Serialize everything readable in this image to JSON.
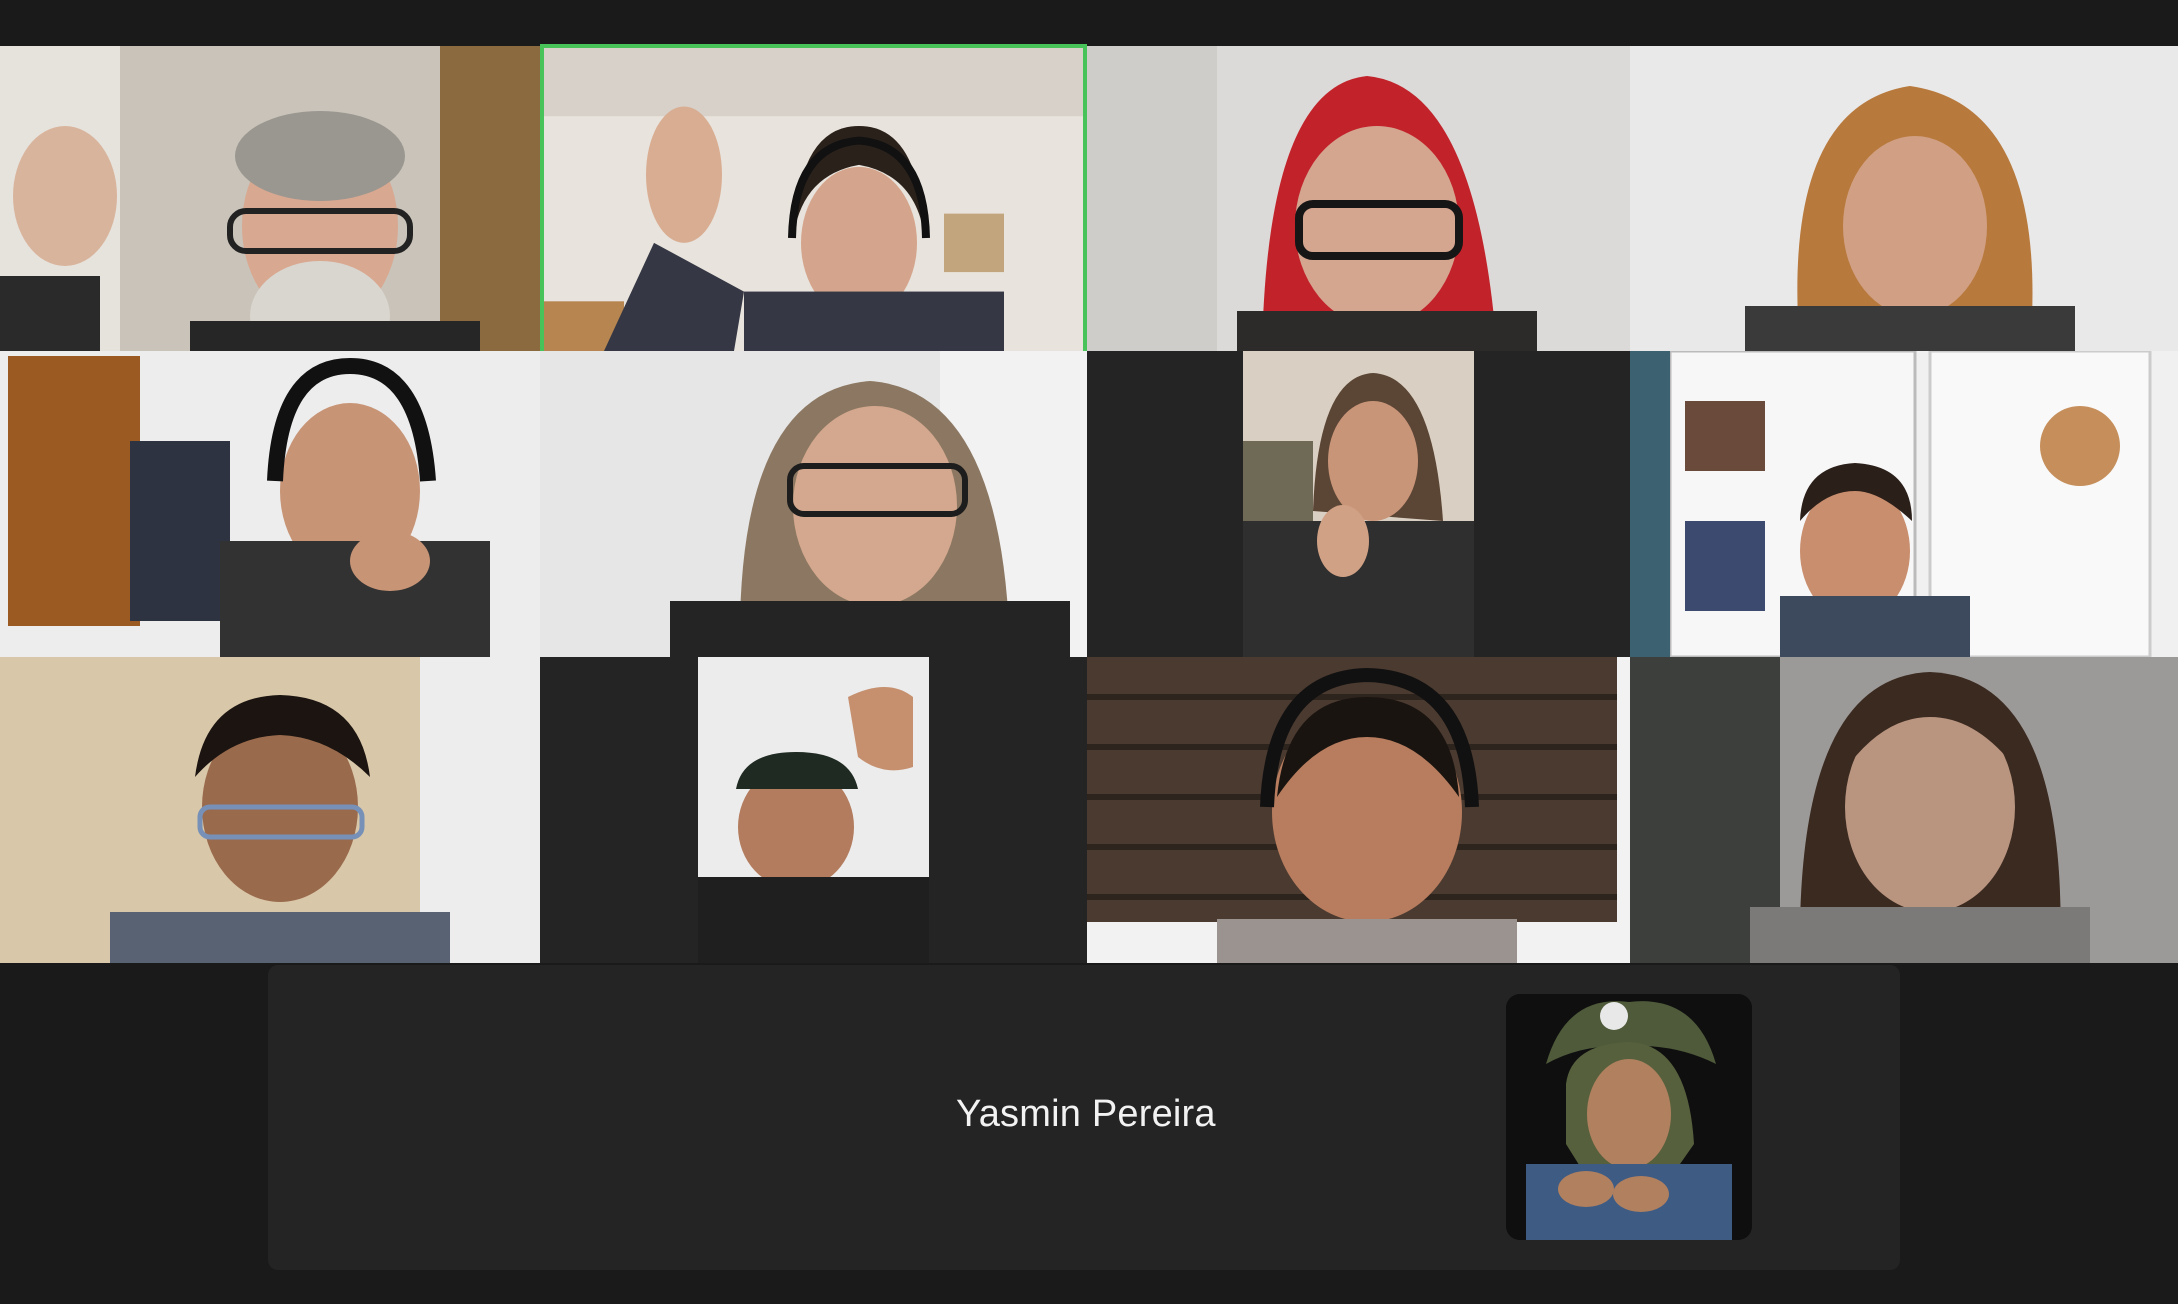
{
  "meeting": {
    "participants": [
      {
        "id": "p1",
        "description": "participant-video"
      },
      {
        "id": "p2",
        "description": "participant-video",
        "active_speaker": true
      },
      {
        "id": "p3",
        "description": "participant-video"
      },
      {
        "id": "p4",
        "description": "participant-video"
      },
      {
        "id": "p5",
        "description": "participant-video"
      },
      {
        "id": "p6",
        "description": "participant-video"
      },
      {
        "id": "p7",
        "description": "participant-video"
      },
      {
        "id": "p8",
        "description": "participant-video"
      },
      {
        "id": "p9",
        "description": "participant-video"
      },
      {
        "id": "p10",
        "description": "participant-video"
      },
      {
        "id": "p11",
        "description": "participant-video"
      },
      {
        "id": "p12",
        "description": "participant-video"
      }
    ],
    "camera_off_participant": {
      "name": "Yasmin Pereira",
      "avatar_icon": "profile-photo"
    }
  },
  "colors": {
    "background": "#1a1a1a",
    "tile_background": "#242424",
    "active_speaker_border": "#47c35a",
    "name_text": "#f2f2f2"
  }
}
